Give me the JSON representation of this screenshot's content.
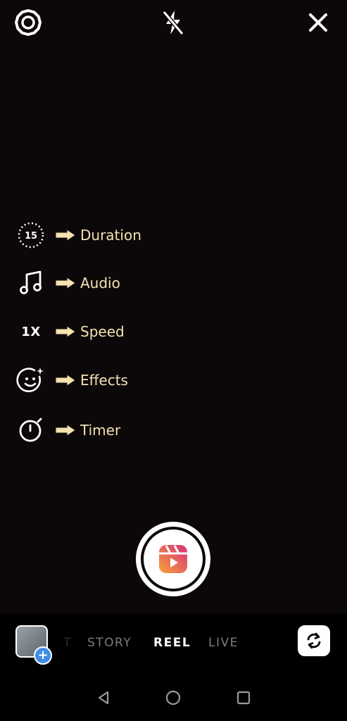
{
  "top_bar": {
    "settings_icon": "gear-icon",
    "flash_icon": "flash-off-icon",
    "close_icon": "close-icon"
  },
  "tools": [
    {
      "icon": "duration-timer-icon",
      "icon_text": "15",
      "label": "Duration"
    },
    {
      "icon": "music-note-icon",
      "label": "Audio"
    },
    {
      "icon": "speed-icon",
      "icon_text": "1X",
      "label": "Speed"
    },
    {
      "icon": "effects-smiley-icon",
      "label": "Effects"
    },
    {
      "icon": "timer-icon",
      "label": "Timer"
    }
  ],
  "shutter": {
    "icon": "reels-icon"
  },
  "modes": {
    "partial": "T",
    "story": "STORY",
    "reel": "REEL",
    "live": "LIVE",
    "active": "REEL"
  },
  "gallery": {
    "badge": "+"
  },
  "colors": {
    "annotation": "#f4e2b2",
    "reels_gradient_start": "#f9a13b",
    "reels_gradient_end": "#d6307a",
    "badge_blue": "#3d8de6"
  },
  "android_nav": {
    "back_icon": "back-triangle-icon",
    "home_icon": "home-circle-icon",
    "recents_icon": "recents-square-icon"
  }
}
